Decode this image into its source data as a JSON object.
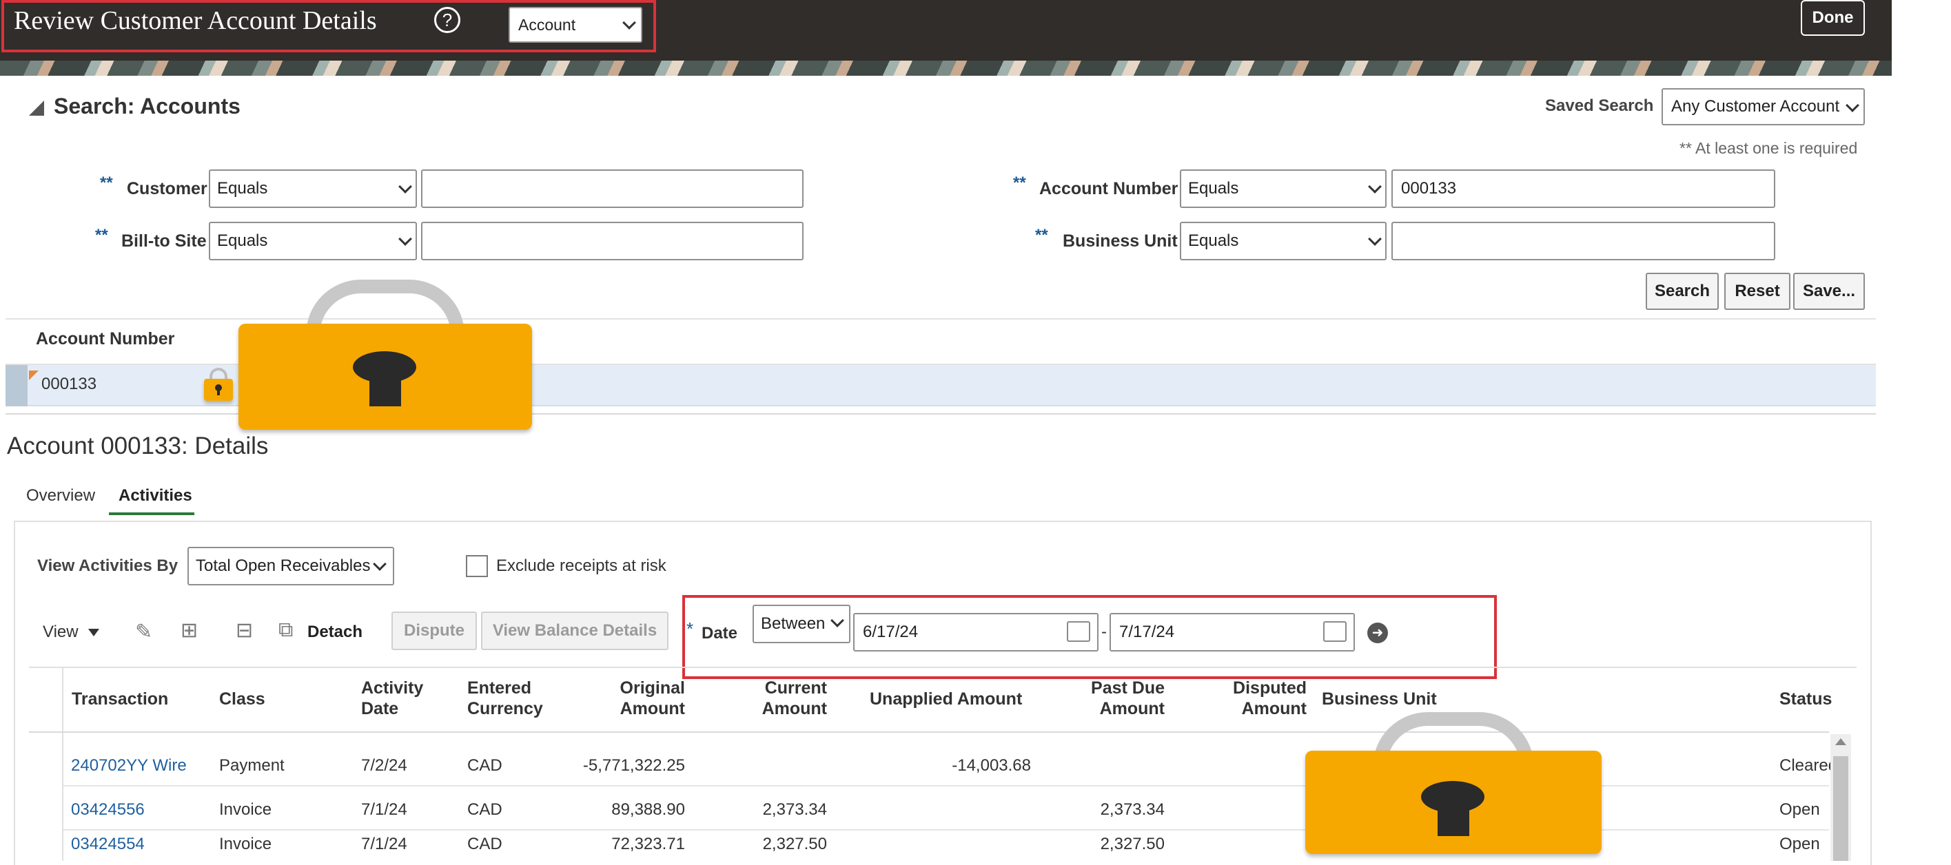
{
  "header": {
    "title": "Review Customer Account Details",
    "help_icon": "?",
    "view_select": "Account",
    "done_label": "Done"
  },
  "search": {
    "heading": "Search: Accounts",
    "saved_search_label": "Saved Search",
    "saved_search_value": "Any Customer Account",
    "required_note": "** At least one is required",
    "required_marker": "**",
    "fields": {
      "customer": {
        "label": "Customer",
        "operator": "Equals",
        "value": ""
      },
      "bill_to_site": {
        "label": "Bill-to Site",
        "operator": "Equals",
        "value": ""
      },
      "account_number": {
        "label": "Account Number",
        "operator": "Equals",
        "value": "000133"
      },
      "business_unit": {
        "label": "Business Unit",
        "operator": "Equals",
        "value": ""
      }
    },
    "buttons": {
      "search": "Search",
      "reset": "Reset",
      "save": "Save..."
    }
  },
  "results": {
    "column": "Account Number",
    "rows": [
      "000133"
    ]
  },
  "details": {
    "title": "Account 000133: Details",
    "tabs": [
      "Overview",
      "Activities"
    ],
    "active_tab": "Activities",
    "view_by_label": "View Activities By",
    "view_by_value": "Total Open Receivables",
    "exclude_label": "Exclude receipts at risk",
    "toolbar": {
      "view": "View",
      "detach": "Detach",
      "dispute": "Dispute",
      "view_balance": "View Balance Details"
    },
    "date_filter": {
      "required": "*",
      "label": "Date",
      "operator": "Between",
      "from": "6/17/24",
      "separator": "-",
      "to": "7/17/24"
    }
  },
  "transactions": {
    "headers": {
      "transaction": "Transaction",
      "class": "Class",
      "activity_date_1": "Activity",
      "activity_date_2": "Date",
      "entered_currency_1": "Entered",
      "entered_currency_2": "Currency",
      "original_amount_1": "Original",
      "original_amount_2": "Amount",
      "current_amount_1": "Current",
      "current_amount_2": "Amount",
      "unapplied_amount": "Unapplied Amount",
      "past_due_amount_1": "Past Due",
      "past_due_amount_2": "Amount",
      "disputed_amount_1": "Disputed",
      "disputed_amount_2": "Amount",
      "business_unit": "Business Unit",
      "status": "Status"
    },
    "rows": [
      {
        "transaction": "240702YY Wire",
        "class": "Payment",
        "date": "7/2/24",
        "currency": "CAD",
        "original": "-5,771,322.25",
        "current": "",
        "unapplied": "-14,003.68",
        "past_due": "",
        "disputed": "",
        "status": "Cleared"
      },
      {
        "transaction": "03424556",
        "class": "Invoice",
        "date": "7/1/24",
        "currency": "CAD",
        "original": "89,388.90",
        "current": "2,373.34",
        "unapplied": "",
        "past_due": "2,373.34",
        "disputed": "",
        "status": "Open"
      },
      {
        "transaction": "03424554",
        "class": "Invoice",
        "date": "7/1/24",
        "currency": "CAD",
        "original": "72,323.71",
        "current": "2,327.50",
        "unapplied": "",
        "past_due": "2,327.50",
        "disputed": "",
        "status": "Open"
      }
    ]
  },
  "colors": {
    "header_bg": "#302d2a",
    "highlight_red": "#d9323a",
    "link_blue": "#1f5f9f",
    "lock_orange": "#f6a800",
    "selected_row": "#e4edf7"
  }
}
